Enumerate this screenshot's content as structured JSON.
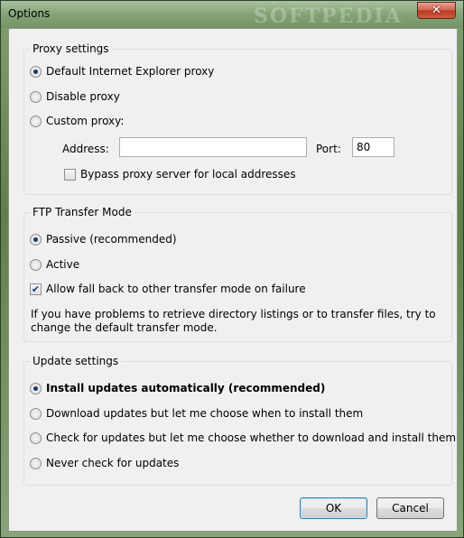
{
  "window": {
    "title": "Options",
    "watermark": "SOFTPEDIA"
  },
  "proxy": {
    "title": "Proxy settings",
    "options": [
      {
        "label": "Default Internet Explorer proxy",
        "checked": true
      },
      {
        "label": "Disable proxy",
        "checked": false
      },
      {
        "label": "Custom proxy:",
        "checked": false
      }
    ],
    "address_label": "Address:",
    "address_value": "",
    "port_label": "Port:",
    "port_value": "80",
    "bypass_label": "Bypass proxy server for local addresses",
    "bypass_checked": false
  },
  "ftp": {
    "title": "FTP Transfer Mode",
    "options": [
      {
        "label": "Passive (recommended)",
        "checked": true
      },
      {
        "label": "Active",
        "checked": false
      }
    ],
    "fallback_label": "Allow fall back to other transfer mode on failure",
    "fallback_checked": true,
    "help_text": "If you have problems to retrieve directory listings or to transfer files, try to change the default transfer mode."
  },
  "updates": {
    "title": "Update settings",
    "options": [
      {
        "label": "Install updates automatically (recommended)",
        "checked": true
      },
      {
        "label": "Download updates but let me choose when to install them",
        "checked": false
      },
      {
        "label": "Check for updates but let me choose whether to download and install them",
        "checked": false
      },
      {
        "label": "Never check for updates",
        "checked": false
      }
    ]
  },
  "buttons": {
    "ok": "OK",
    "cancel": "Cancel"
  }
}
